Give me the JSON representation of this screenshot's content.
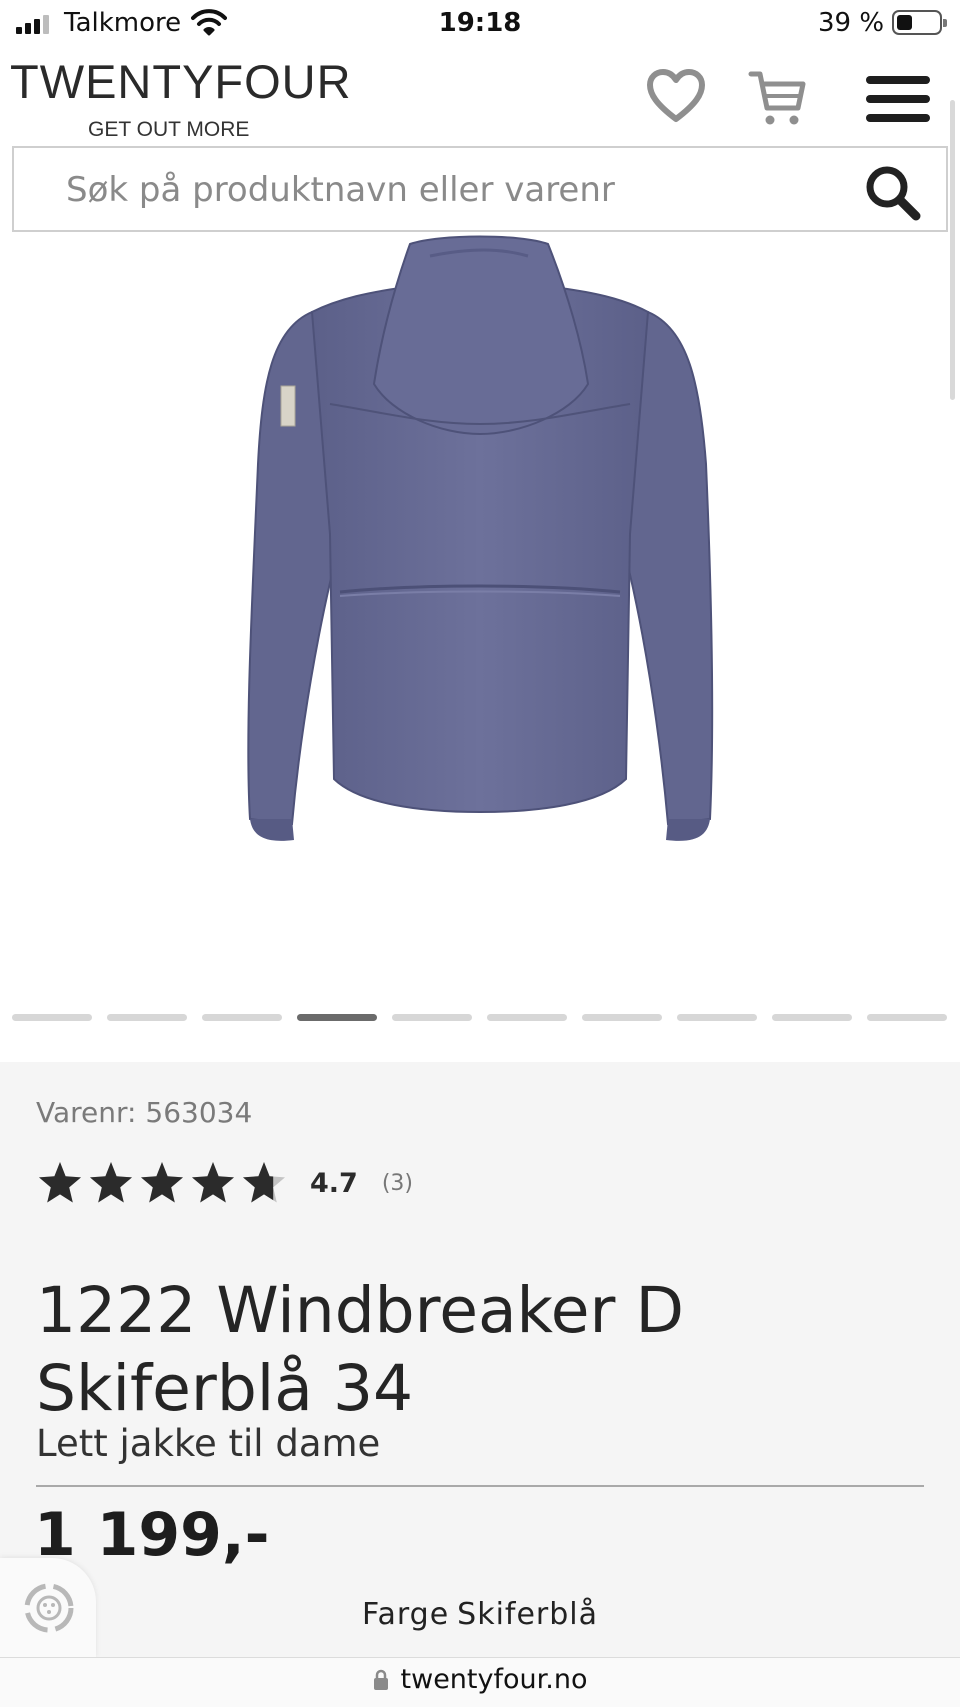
{
  "status_bar": {
    "carrier": "Talkmore",
    "time": "19:18",
    "battery_percent": "39 %",
    "battery_level": 0.39
  },
  "header": {
    "logo_text": "TWENTYFOUR",
    "logo_tagline": "GET OUT MORE",
    "wishlist_icon": "heart-icon",
    "cart_icon": "cart-icon",
    "menu_icon": "hamburger-menu-icon"
  },
  "search": {
    "placeholder": "Søk på produktnavn eller varenr",
    "value": "",
    "icon": "search-icon"
  },
  "gallery": {
    "image_count": 10,
    "active_index": 3,
    "jacket_color": "#6b6f98"
  },
  "product": {
    "sku_label": "Varenr:",
    "sku_value": "563034",
    "rating_value": "4.7",
    "rating_count": "(3)",
    "rating_stars": 4.7,
    "title": "1222 Windbreaker D Skiferblå 34",
    "subtitle": "Lett jakke til dame",
    "price": "1 199,-",
    "color_label": "Farge",
    "color_value": "Skiferblå"
  },
  "browser": {
    "url": "twentyfour.no",
    "lock_icon": "lock-icon"
  },
  "colors": {
    "star_filled": "#2b2b2b",
    "star_empty": "#c4c4c4",
    "panel_bg": "#f5f5f5"
  }
}
